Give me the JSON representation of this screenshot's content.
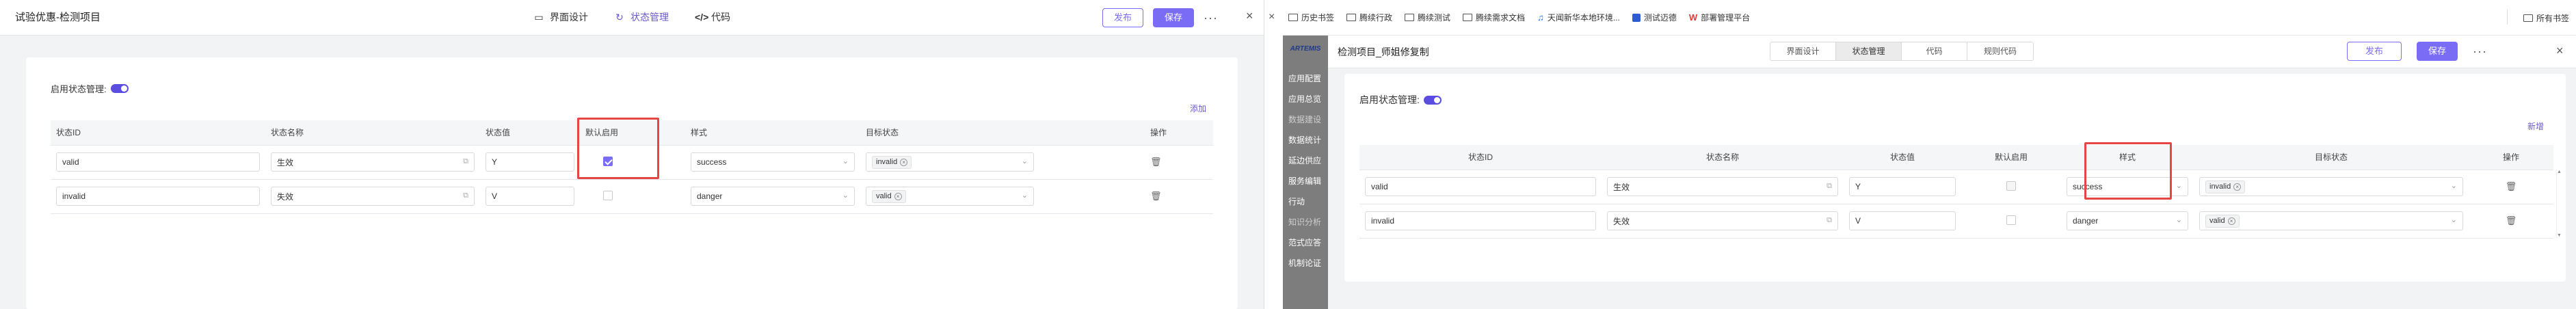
{
  "left": {
    "title": "试验优惠-检测项目",
    "tabs": [
      {
        "label": "界面设计",
        "icon": "monitor-icon"
      },
      {
        "label": "状态管理",
        "icon": "sync-icon"
      },
      {
        "label": "代码",
        "icon": "code-icon"
      }
    ],
    "publish_label": "发布",
    "save_label": "保存",
    "more_label": "···",
    "close_label": "×",
    "switch_label": "启用状态管理:",
    "add_label": "添加",
    "columns": [
      "状态ID",
      "状态名称",
      "状态值",
      "默认启用",
      "样式",
      "目标状态",
      "操作"
    ],
    "rows": [
      {
        "id": "valid",
        "name": "生效",
        "value": "Y",
        "checked": true,
        "style": "success",
        "target": "invalid"
      },
      {
        "id": "invalid",
        "name": "失效",
        "value": "V",
        "checked": false,
        "style": "danger",
        "target": "valid"
      }
    ]
  },
  "bookmarks": {
    "items": [
      {
        "label": "历史书签",
        "icon": "folder-icon"
      },
      {
        "label": "腾续行政",
        "icon": "folder-icon"
      },
      {
        "label": "腾续测试",
        "icon": "folder-icon"
      },
      {
        "label": "腾续需求文档",
        "icon": "folder-icon"
      },
      {
        "label": "天闻新华本地环境...",
        "icon": "music-icon"
      },
      {
        "label": "测试迈德",
        "icon": "badge-icon"
      },
      {
        "label": "部署管理平台",
        "icon": "logo-icon"
      }
    ],
    "all_label": "所有书签"
  },
  "sidebar": {
    "logo": "ARTEMIS",
    "items": [
      "应用配置",
      "应用总览",
      "数据建设",
      "数据统计",
      "延边供应",
      "服务编辑",
      "行动",
      "知识分析",
      "范式应答",
      "机制论证"
    ]
  },
  "modal": {
    "title": "检测项目_师姐修复制",
    "tabs": [
      "界面设计",
      "状态管理",
      "代码",
      "规则代码"
    ],
    "active_tab": 1,
    "publish_label": "发布",
    "save_label": "保存",
    "more_label": "···",
    "close_label": "×",
    "switch_label": "启用状态管理:",
    "add_label": "新增",
    "columns": [
      "状态ID",
      "状态名称",
      "状态值",
      "默认启用",
      "样式",
      "目标状态",
      "操作"
    ],
    "rows": [
      {
        "id": "valid",
        "name": "生效",
        "value": "Y",
        "checked": false,
        "style": "success",
        "target": "invalid"
      },
      {
        "id": "invalid",
        "name": "失效",
        "value": "V",
        "checked": false,
        "style": "danger",
        "target": "valid"
      }
    ]
  },
  "colors": {
    "accent": "#7b6cf6",
    "highlight": "#e64545"
  }
}
